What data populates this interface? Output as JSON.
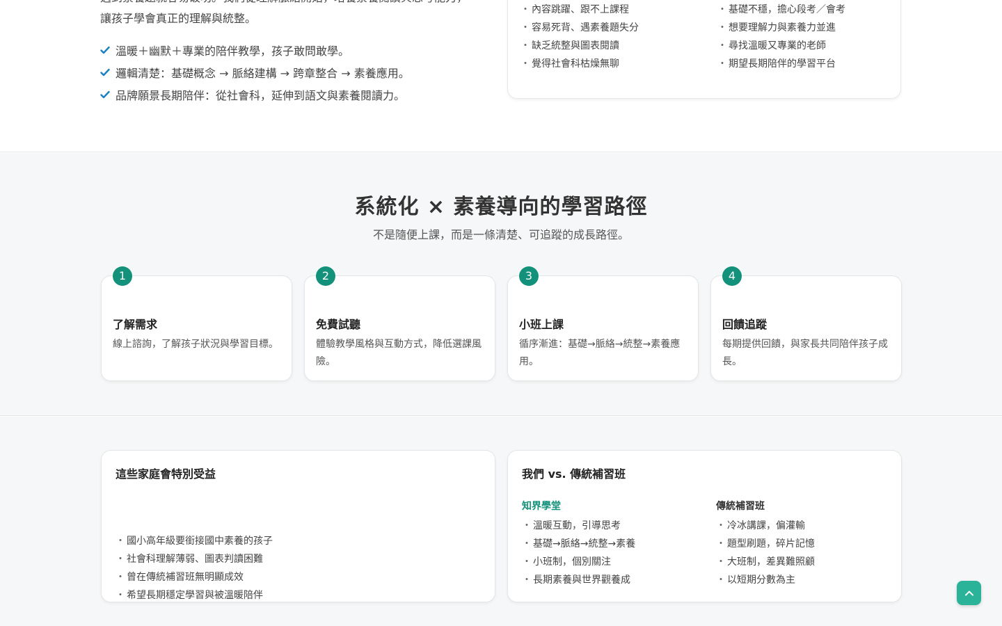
{
  "intro": {
    "line1": "遇到素養題就容易破功。我們從理解脈絡開始，培養素養閱讀與思考能力，",
    "line2": "讓孩子學會真正的理解與統整。"
  },
  "checks": [
    "溫暖＋幽默＋專業的陪伴教學，孩子敢問敢學。",
    "邏輯清楚：基礎概念 → 脈絡建構 → 跨章整合 → 素養應用。",
    "品牌願景長期陪伴：從社會科，延伸到語文與素養閱讀力。"
  ],
  "pain_points": {
    "left": [
      "內容跳躍、跟不上課程",
      "容易死背、遇素養題失分",
      "缺乏統整與圖表閱讀",
      "覺得社會科枯燥無聊"
    ],
    "right": [
      "基礎不穩，擔心段考／會考",
      "想要理解力與素養力並進",
      "尋找溫暖又專業的老師",
      "期望長期陪伴的學習平台"
    ]
  },
  "path": {
    "title": "系統化 × 素養導向的學習路徑",
    "subtitle": "不是隨便上課，而是一條清楚、可追蹤的成長路徑。",
    "steps": [
      {
        "num": "1",
        "title": "了解需求",
        "desc": "線上諮詢，了解孩子狀況與學習目標。"
      },
      {
        "num": "2",
        "title": "免費試聽",
        "desc": "體驗教學風格與互動方式，降低選課風險。"
      },
      {
        "num": "3",
        "title": "小班上課",
        "desc": "循序漸進：基礎→脈絡→統整→素養應用。"
      },
      {
        "num": "4",
        "title": "回饋追蹤",
        "desc": "每期提供回饋，與家長共同陪伴孩子成長。"
      }
    ]
  },
  "families": {
    "title": "這些家庭會特別受益",
    "items": [
      "國小高年級要銜接國中素養的孩子",
      "社會科理解薄弱、圖表判讀困難",
      "曾在傳統補習班無明顯成效",
      "希望長期穩定學習與被溫暖陪伴"
    ]
  },
  "compare": {
    "title": "我們 vs. 傳統補習班",
    "ours_head": "知界學堂",
    "ours": [
      "溫暖互動，引導思考",
      "基礎→脈絡→統整→素養",
      "小班制，個別關注",
      "長期素養與世界觀養成"
    ],
    "trad_head": "傳統補習班",
    "trad": [
      "冷冰講課，偏灌輸",
      "題型刷題，碎片記憶",
      "大班制，差異難照顧",
      "以短期分數為主"
    ]
  },
  "bullet": "・",
  "colors": {
    "brand": "#14917a",
    "check": "#1a7fc1",
    "top_button": "#2bb39a"
  },
  "icons": {
    "check": "check-icon",
    "back_to_top": "chevron-up-icon"
  }
}
